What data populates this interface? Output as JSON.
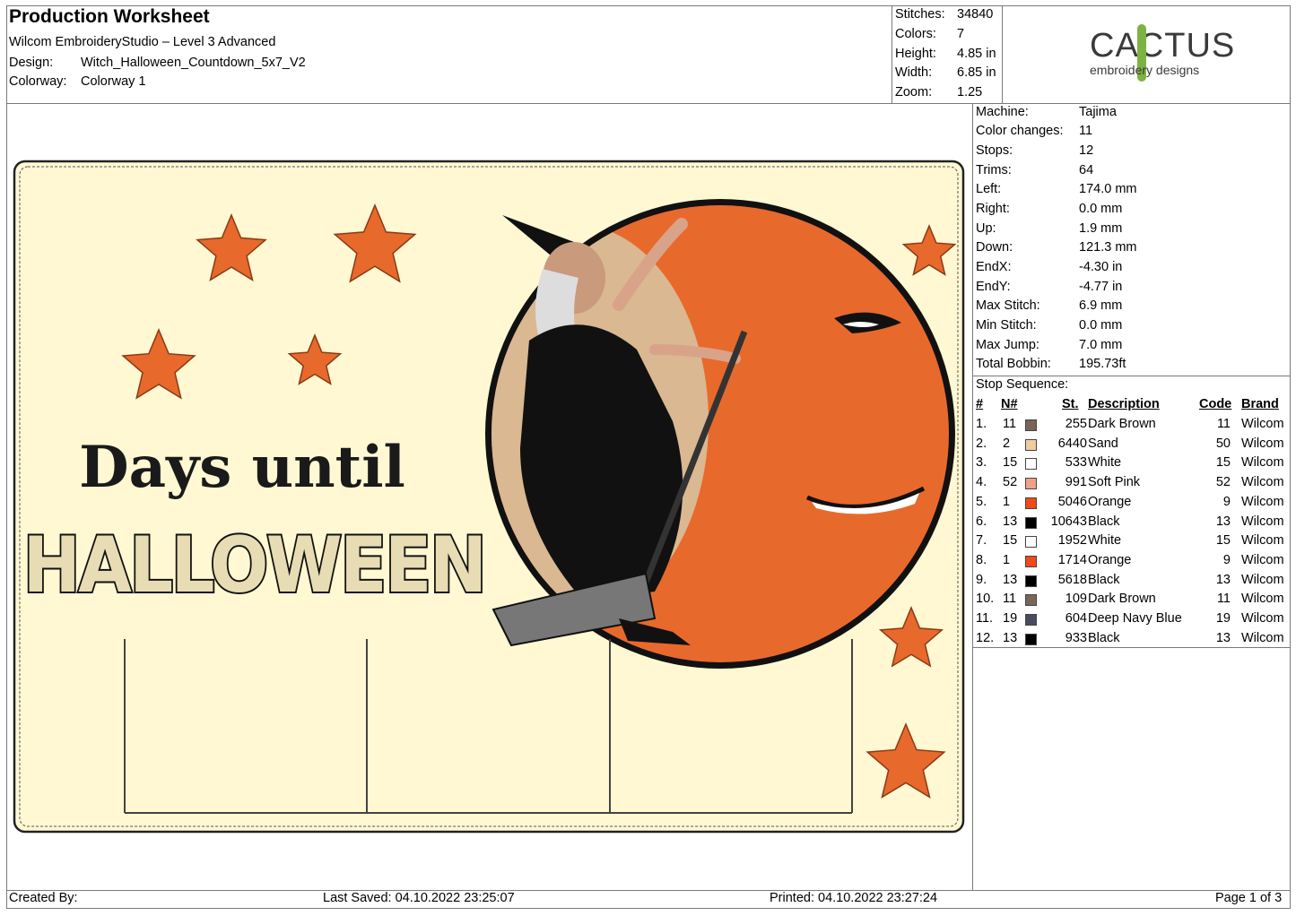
{
  "header": {
    "title": "Production Worksheet",
    "software": "Wilcom EmbroideryStudio – Level 3 Advanced",
    "design_label": "Design:",
    "design_value": "Witch_Halloween_Countdown_5x7_V2",
    "colorway_label": "Colorway:",
    "colorway_value": "Colorway 1"
  },
  "stats": [
    {
      "label": "Stitches:",
      "value": "34840"
    },
    {
      "label": "Colors:",
      "value": "7"
    },
    {
      "label": "Height:",
      "value": "4.85 in"
    },
    {
      "label": "Width:",
      "value": "6.85 in"
    },
    {
      "label": "Zoom:",
      "value": "1.25"
    }
  ],
  "logo": {
    "main": "CACTUS",
    "sub": "embroidery designs",
    "accent": "#7cb342"
  },
  "machine_stats": [
    {
      "label": "Machine:",
      "value": "Tajima"
    },
    {
      "label": "Color changes:",
      "value": "11"
    },
    {
      "label": "Stops:",
      "value": "12"
    },
    {
      "label": "Trims:",
      "value": "64"
    },
    {
      "label": "Left:",
      "value": "174.0 mm"
    },
    {
      "label": "Right:",
      "value": "0.0 mm"
    },
    {
      "label": "Up:",
      "value": "1.9 mm"
    },
    {
      "label": "Down:",
      "value": "121.3 mm"
    },
    {
      "label": "EndX:",
      "value": "-4.30 in"
    },
    {
      "label": "EndY:",
      "value": "-4.77 in"
    },
    {
      "label": "Max Stitch:",
      "value": "6.9 mm"
    },
    {
      "label": "Min Stitch:",
      "value": "0.0 mm"
    },
    {
      "label": "Max Jump:",
      "value": "7.0 mm"
    },
    {
      "label": "Total Bobbin:",
      "value": "195.73ft"
    }
  ],
  "stop_sequence": {
    "title": "Stop Sequence:",
    "columns": {
      "num": "#",
      "n": "N#",
      "st": "St.",
      "desc": "Description",
      "code": "Code",
      "brand": "Brand"
    },
    "rows": [
      {
        "num": "1.",
        "n": "11",
        "color": "#7a6558",
        "st": "255",
        "desc": "Dark Brown",
        "code": "11",
        "brand": "Wilcom"
      },
      {
        "num": "2.",
        "n": "2",
        "color": "#f2caa0",
        "st": "6440",
        "desc": "Sand",
        "code": "50",
        "brand": "Wilcom"
      },
      {
        "num": "3.",
        "n": "15",
        "color": "#ffffff",
        "st": "533",
        "desc": "White",
        "code": "15",
        "brand": "Wilcom"
      },
      {
        "num": "4.",
        "n": "52",
        "color": "#f0a088",
        "st": "991",
        "desc": "Soft Pink",
        "code": "52",
        "brand": "Wilcom"
      },
      {
        "num": "5.",
        "n": "1",
        "color": "#f04a1a",
        "st": "5046",
        "desc": "Orange",
        "code": "9",
        "brand": "Wilcom"
      },
      {
        "num": "6.",
        "n": "13",
        "color": "#000000",
        "st": "10643",
        "desc": "Black",
        "code": "13",
        "brand": "Wilcom"
      },
      {
        "num": "7.",
        "n": "15",
        "color": "#ffffff",
        "st": "1952",
        "desc": "White",
        "code": "15",
        "brand": "Wilcom"
      },
      {
        "num": "8.",
        "n": "1",
        "color": "#f04a1a",
        "st": "1714",
        "desc": "Orange",
        "code": "9",
        "brand": "Wilcom"
      },
      {
        "num": "9.",
        "n": "13",
        "color": "#000000",
        "st": "5618",
        "desc": "Black",
        "code": "13",
        "brand": "Wilcom"
      },
      {
        "num": "10.",
        "n": "11",
        "color": "#7a6558",
        "st": "109",
        "desc": "Dark Brown",
        "code": "11",
        "brand": "Wilcom"
      },
      {
        "num": "11.",
        "n": "19",
        "color": "#4a4a5e",
        "st": "604",
        "desc": "Deep Navy Blue",
        "code": "19",
        "brand": "Wilcom"
      },
      {
        "num": "12.",
        "n": "13",
        "color": "#000000",
        "st": "933",
        "desc": "Black",
        "code": "13",
        "brand": "Wilcom"
      }
    ]
  },
  "design": {
    "line1": "Days until",
    "line2": "HALLOWEEN",
    "background": "#fff8d2",
    "moon": "#e8692c",
    "star": "#e8692c"
  },
  "footer": {
    "created_by": "Created By:",
    "last_saved": "Last Saved: 04.10.2022 23:25:07",
    "printed": "Printed: 04.10.2022 23:27:24",
    "page": "Page 1 of 3"
  }
}
